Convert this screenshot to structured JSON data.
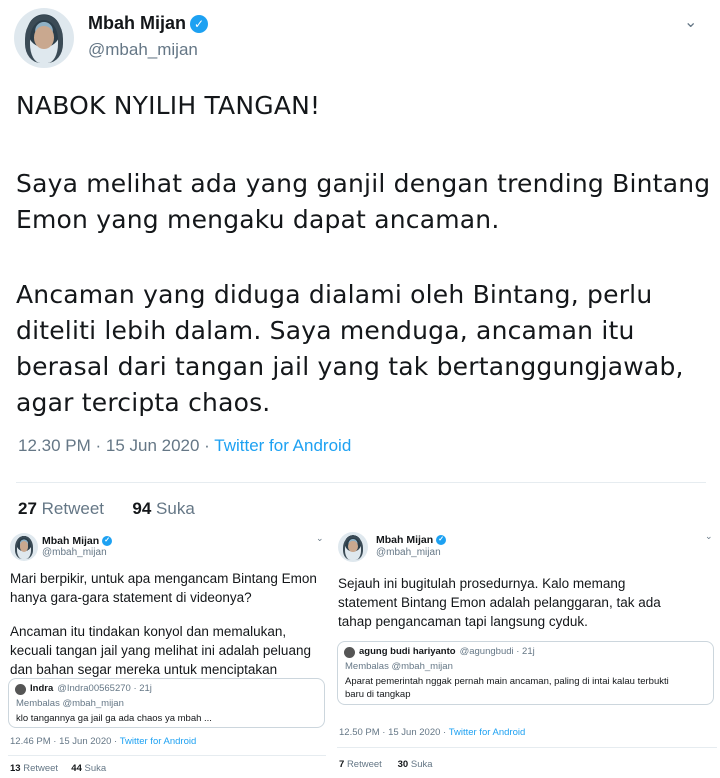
{
  "main": {
    "name": "Mbah Mijan",
    "handle": "@mbah_mijan",
    "paragraphs": [
      "NABOK NYILIH TANGAN!",
      "Saya melihat ada yang ganjil dengan trending Bintang Emon yang mengaku dapat ancaman.",
      "Ancaman yang diduga dialami oleh Bintang, perlu diteliti lebih dalam. Saya menduga, ancaman itu berasal dari tangan jail yang tak bertanggungjawab, agar tercipta chaos."
    ],
    "time": "12.30 PM · 15 Jun 2020 · ",
    "via": "Twitter for Android",
    "retweets": "27",
    "retweet_label": "Retweet",
    "likes": "94",
    "like_label": "Suka"
  },
  "left_tweet": {
    "name": "Mbah Mijan",
    "handle": "@mbah_mijan",
    "p1": "Mari berpikir, untuk apa mengancam Bintang Emon hanya gara-gara statement di videonya?",
    "p2": "Ancaman itu tindakan konyol dan memalukan, kecuali tangan jail yang melihat ini adalah peluang dan bahan segar mereka untuk menciptakan kekacauan.",
    "quote": {
      "name": "Indra",
      "handle": "@Indra00565270 · 21j",
      "reply": "Membalas @mbah_mijan",
      "text": "klo tangannya ga jail ga ada chaos ya mbah ..."
    },
    "time": "12.46 PM · 15 Jun 2020 · ",
    "via": "Twitter for Android",
    "retweets": "13",
    "retweet_label": "Retweet",
    "likes": "44",
    "like_label": "Suka"
  },
  "right_tweet": {
    "name": "Mbah Mijan",
    "handle": "@mbah_mijan",
    "p1": "Sejauh ini bugitulah prosedurnya. Kalo memang statement Bintang Emon adalah pelanggaran, tak ada tahap pengancaman tapi langsung cyduk.",
    "quote": {
      "name": "agung budi hariyanto",
      "handle": "@agungbudi · 21j",
      "reply": "Membalas @mbah_mijan",
      "text": "Aparat pemerintah nggak pernah main ancaman, paling di intai kalau terbukti baru di tangkap"
    },
    "time": "12.50 PM · 15 Jun 2020 · ",
    "via": "Twitter for Android",
    "retweets": "7",
    "retweet_label": "Retweet",
    "likes": "30",
    "like_label": "Suka"
  },
  "icons": {
    "verified": "✓",
    "chevron": "⌄"
  },
  "colors": {
    "accent": "#1da1f2",
    "muted": "#657786"
  }
}
